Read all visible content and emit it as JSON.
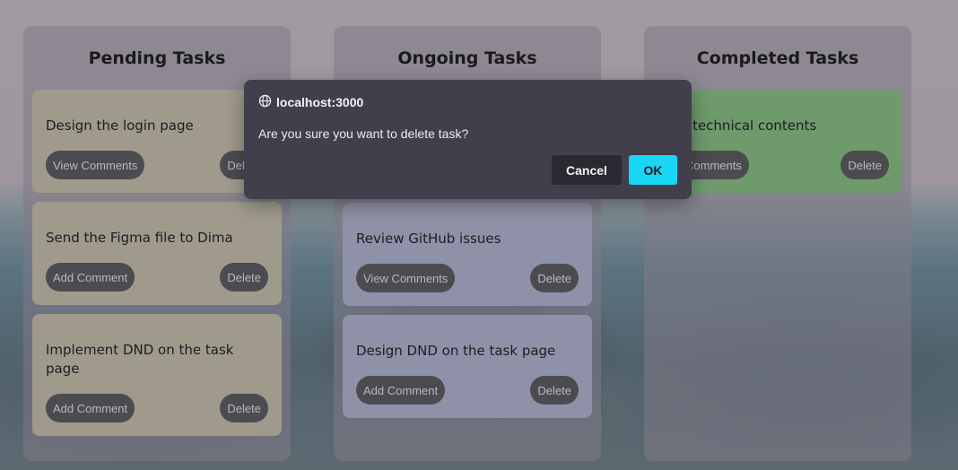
{
  "columns": [
    {
      "title": "Pending Tasks",
      "cards": [
        {
          "title": "Design the login page",
          "action": "View Comments",
          "delete": "Delete"
        },
        {
          "title": "Send the Figma file to Dima",
          "action": "Add Comment",
          "delete": "Delete"
        },
        {
          "title": "Implement DND on the task page",
          "action": "Add Comment",
          "delete": "Delete"
        }
      ]
    },
    {
      "title": "Ongoing Tasks",
      "cards": [
        {
          "title": "Review GitHub issues",
          "action": "View Comments",
          "delete": "Delete"
        },
        {
          "title": "Design DND on the task page",
          "action": "Add Comment",
          "delete": "Delete"
        }
      ]
    },
    {
      "title": "Completed Tasks",
      "cards": [
        {
          "title": "ate technical contents",
          "action": "w Comments",
          "delete": "Delete"
        }
      ]
    }
  ],
  "dialog": {
    "origin": "localhost:3000",
    "message": "Are you sure you want to delete task?",
    "cancel_label": "Cancel",
    "ok_label": "OK"
  },
  "colors": {
    "pending_card": "#9f9a8c",
    "ongoing_card": "#8f91a8",
    "completed_card": "#6e9a6c",
    "ok_button": "#1ad6f5",
    "dialog_bg": "#423f4c"
  }
}
